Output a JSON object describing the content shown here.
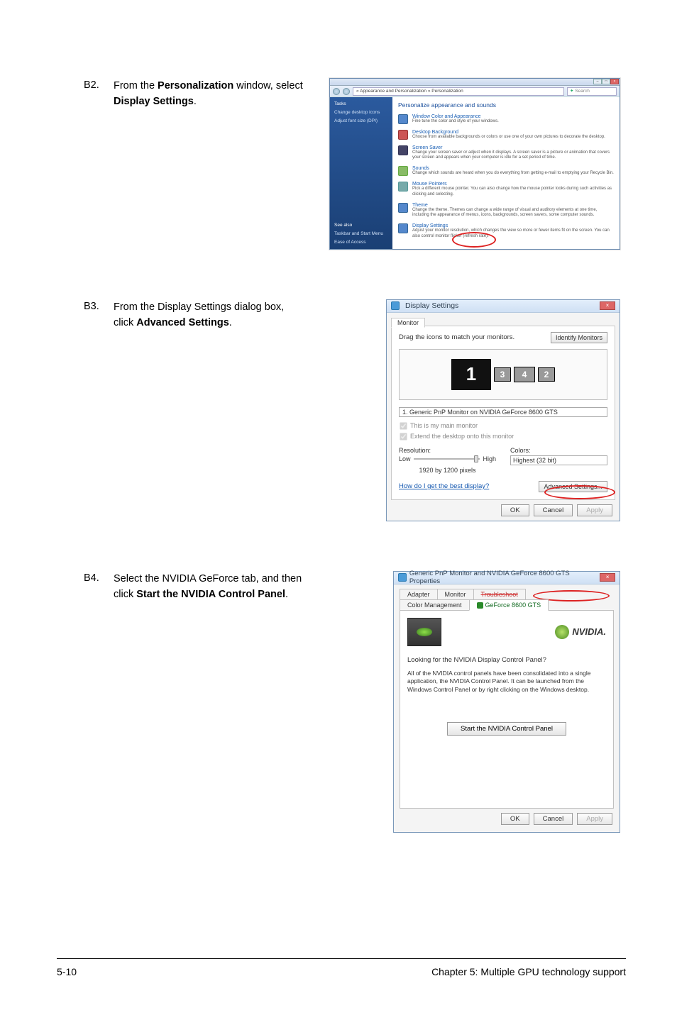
{
  "steps": {
    "b2": {
      "num": "B2.",
      "text_pre": "From the ",
      "bold1": "Personalization",
      "text_mid": " window, select ",
      "bold2": "Display Settings",
      "text_post": "."
    },
    "b3": {
      "num": "B3.",
      "text_pre": "From the Display Settings dialog box, click ",
      "bold1": "Advanced Settings",
      "text_post": "."
    },
    "b4": {
      "num": "B4.",
      "text_pre": "Select the NVIDIA GeForce tab, and then click ",
      "bold1": "Start the NVIDIA Control Panel",
      "text_post": "."
    }
  },
  "pers": {
    "breadcrumb": "« Appearance and Personalization » Personalization",
    "search": "Search",
    "sidebar_top": {
      "tasks": "Tasks",
      "chg": "Change desktop icons",
      "adj": "Adjust font size (DPI)"
    },
    "sidebar_bot": {
      "see": "See also",
      "task": "Taskbar and Start Menu",
      "ease": "Ease of Access"
    },
    "heading": "Personalize appearance and sounds",
    "items": [
      {
        "title": "Window Color and Appearance",
        "desc": "Fine tune the color and style of your windows."
      },
      {
        "title": "Desktop Background",
        "desc": "Choose from available backgrounds or colors or use one of your own pictures to decorate the desktop."
      },
      {
        "title": "Screen Saver",
        "desc": "Change your screen saver or adjust when it displays. A screen saver is a picture or animation that covers your screen and appears when your computer is idle for a set period of time."
      },
      {
        "title": "Sounds",
        "desc": "Change which sounds are heard when you do everything from getting e-mail to emptying your Recycle Bin."
      },
      {
        "title": "Mouse Pointers",
        "desc": "Pick a different mouse pointer. You can also change how the mouse pointer looks during such activities as clicking and selecting."
      },
      {
        "title": "Theme",
        "desc": "Change the theme. Themes can change a wide range of visual and auditory elements at one time, including the appearance of menus, icons, backgrounds, screen savers, some computer sounds."
      },
      {
        "title": "Display Settings",
        "desc": "Adjust your monitor resolution, which changes the view so more or fewer items fit on the screen. You can also control monitor flicker (refresh rate)."
      }
    ]
  },
  "disp": {
    "title": "Display Settings",
    "tab": "Monitor",
    "drag": "Drag the icons to match your monitors.",
    "identify": "Identify Monitors",
    "mons": {
      "m1": "1",
      "m3": "3",
      "m4": "4",
      "m2": "2"
    },
    "sel": "1. Generic PnP Monitor on NVIDIA GeForce 8600 GTS",
    "chk_main": "This is my main monitor",
    "chk_ext": "Extend the desktop onto this monitor",
    "res_lbl": "Resolution:",
    "low": "Low",
    "high": "High",
    "res_val": "1920 by 1200 pixels",
    "col_lbl": "Colors:",
    "col_val": "Highest (32 bit)",
    "link": "How do I get the best display?",
    "adv": "Advanced Settings...",
    "ok": "OK",
    "cancel": "Cancel",
    "apply": "Apply"
  },
  "nv": {
    "title": "Generic PnP Monitor and NVIDIA GeForce 8600 GTS Properties",
    "tabs": {
      "adapter": "Adapter",
      "monitor": "Monitor",
      "trouble": "Troubleshoot",
      "color": "Color Management",
      "gf": "GeForce 8600 GTS"
    },
    "logo": "NVIDIA.",
    "q": "Looking for the NVIDIA Display Control Panel?",
    "p": "All of the NVIDIA control panels have been consolidated into a single application, the NVIDIA Control Panel. It can be launched from the Windows Control Panel or by right clicking on the Windows desktop.",
    "start": "Start the NVIDIA Control Panel",
    "ok": "OK",
    "cancel": "Cancel",
    "apply": "Apply"
  },
  "footer": {
    "left": "5-10",
    "right": "Chapter 5: Multiple GPU technology support"
  }
}
